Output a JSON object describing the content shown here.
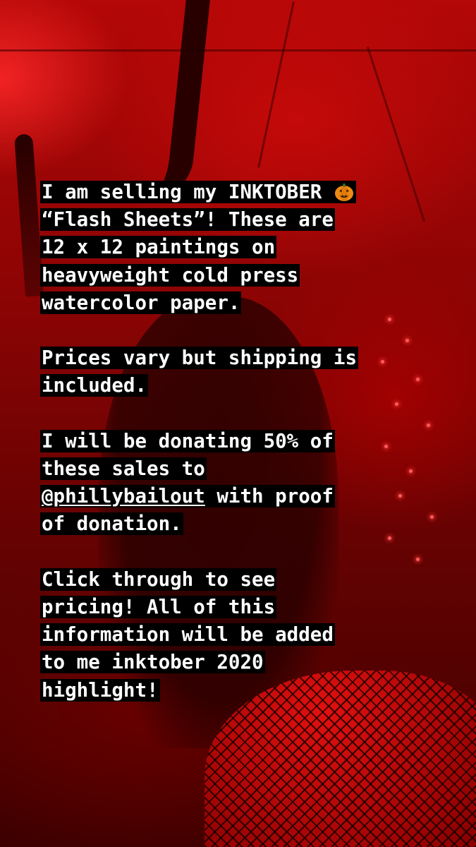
{
  "story": {
    "caption": {
      "line1": "I am selling my INKTOBER ",
      "line1_emoji": "jack-o-lantern-icon",
      "line2": "“Flash Sheets”! These are",
      "line3": "12 x 12 paintings on",
      "line4": "heavyweight cold press",
      "line5": "watercolor paper.",
      "line6": "Prices vary but shipping is",
      "line7": "included.",
      "line8": "I will be donating 50% of",
      "line9": "these sales to",
      "line10_mention": "@phillybailout",
      "line10_rest": " with proof",
      "line11": "of donation.",
      "line12": "Click through to see",
      "line13": "pricing! All of this",
      "line14": "information will be added",
      "line15": "to me inktober 2020",
      "line16": "highlight!"
    }
  },
  "colors": {
    "background": "#8c0404",
    "highlight": "#000000",
    "text": "#ffffff"
  }
}
